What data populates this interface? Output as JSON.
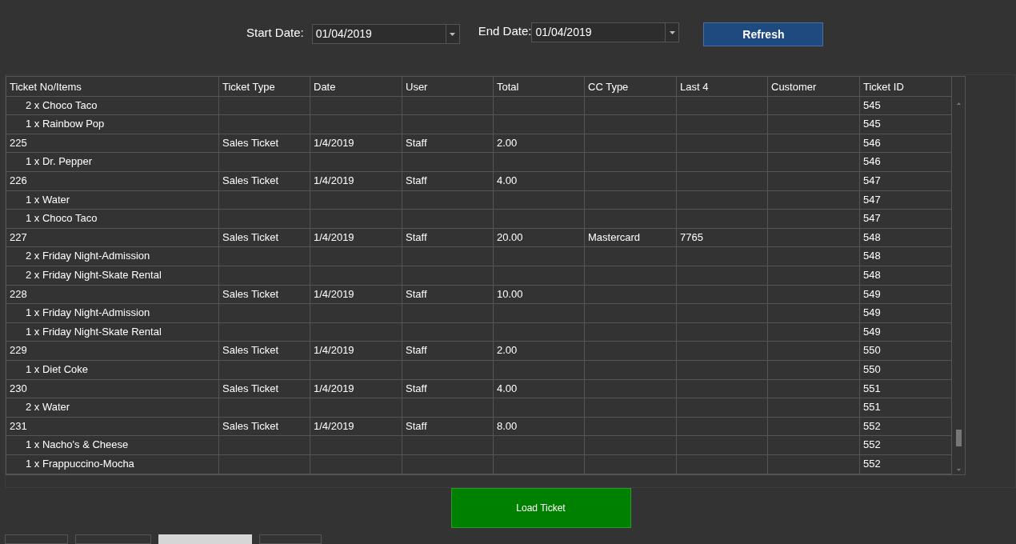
{
  "filters": {
    "start_label": "Start Date:",
    "start_value": "01/04/2019",
    "end_label": "End Date:",
    "end_value": "01/04/2019",
    "refresh": "Refresh"
  },
  "table": {
    "columns": [
      "Ticket No/Items",
      "Ticket Type",
      "Date",
      "User",
      "Total",
      "CC Type",
      "Last 4",
      "Customer",
      "Ticket ID"
    ],
    "rows": [
      {
        "kind": "item",
        "cells": [
          "2 x Choco Taco",
          "",
          "",
          "",
          "",
          "",
          "",
          "",
          "545"
        ]
      },
      {
        "kind": "item",
        "cells": [
          "1 x Rainbow Pop",
          "",
          "",
          "",
          "",
          "",
          "",
          "",
          "545"
        ]
      },
      {
        "kind": "ticket",
        "cells": [
          "225",
          "Sales Ticket",
          "1/4/2019",
          "Staff",
          "2.00",
          "",
          "",
          "",
          "546"
        ]
      },
      {
        "kind": "item",
        "cells": [
          "1 x Dr. Pepper",
          "",
          "",
          "",
          "",
          "",
          "",
          "",
          "546"
        ]
      },
      {
        "kind": "ticket",
        "cells": [
          "226",
          "Sales Ticket",
          "1/4/2019",
          "Staff",
          "4.00",
          "",
          "",
          "",
          "547"
        ]
      },
      {
        "kind": "item",
        "cells": [
          "1 x Water",
          "",
          "",
          "",
          "",
          "",
          "",
          "",
          "547"
        ]
      },
      {
        "kind": "item",
        "cells": [
          "1 x Choco Taco",
          "",
          "",
          "",
          "",
          "",
          "",
          "",
          "547"
        ]
      },
      {
        "kind": "ticket",
        "cells": [
          "227",
          "Sales Ticket",
          "1/4/2019",
          "Staff",
          "20.00",
          "Mastercard",
          "7765",
          "",
          "548"
        ]
      },
      {
        "kind": "item",
        "cells": [
          "2 x Friday Night-Admission",
          "",
          "",
          "",
          "",
          "",
          "",
          "",
          "548"
        ]
      },
      {
        "kind": "item",
        "cells": [
          "2 x Friday Night-Skate Rental",
          "",
          "",
          "",
          "",
          "",
          "",
          "",
          "548"
        ]
      },
      {
        "kind": "ticket",
        "cells": [
          "228",
          "Sales Ticket",
          "1/4/2019",
          "Staff",
          "10.00",
          "",
          "",
          "",
          "549"
        ]
      },
      {
        "kind": "item",
        "cells": [
          "1 x Friday Night-Admission",
          "",
          "",
          "",
          "",
          "",
          "",
          "",
          "549"
        ]
      },
      {
        "kind": "item",
        "cells": [
          "1 x Friday Night-Skate Rental",
          "",
          "",
          "",
          "",
          "",
          "",
          "",
          "549"
        ]
      },
      {
        "kind": "ticket",
        "cells": [
          "229",
          "Sales Ticket",
          "1/4/2019",
          "Staff",
          "2.00",
          "",
          "",
          "",
          "550"
        ]
      },
      {
        "kind": "item",
        "cells": [
          "1 x Diet Coke",
          "",
          "",
          "",
          "",
          "",
          "",
          "",
          "550"
        ]
      },
      {
        "kind": "ticket",
        "cells": [
          "230",
          "Sales Ticket",
          "1/4/2019",
          "Staff",
          "4.00",
          "",
          "",
          "",
          "551"
        ]
      },
      {
        "kind": "item",
        "cells": [
          "2 x Water",
          "",
          "",
          "",
          "",
          "",
          "",
          "",
          "551"
        ]
      },
      {
        "kind": "ticket",
        "cells": [
          "231",
          "Sales Ticket",
          "1/4/2019",
          "Staff",
          "8.00",
          "",
          "",
          "",
          "552"
        ]
      },
      {
        "kind": "item",
        "cells": [
          "1 x Nacho's & Cheese",
          "",
          "",
          "",
          "",
          "",
          "",
          "",
          "552"
        ]
      },
      {
        "kind": "item",
        "cells": [
          "1 x Frappuccino-Mocha",
          "",
          "",
          "",
          "",
          "",
          "",
          "",
          "552"
        ]
      }
    ]
  },
  "load_button": "Load Ticket",
  "bottom_tabs": [
    {
      "selected": false
    },
    {
      "selected": false
    },
    {
      "selected": true
    },
    {
      "selected": false
    }
  ]
}
